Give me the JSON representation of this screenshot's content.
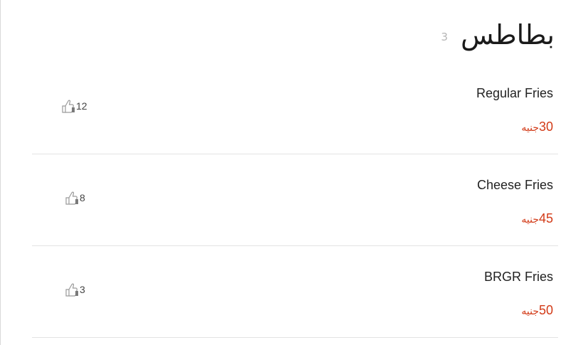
{
  "category": {
    "title": "بطاطس",
    "count": "3"
  },
  "items": [
    {
      "name": "Regular Fries",
      "price": "30",
      "currency": "جنيه",
      "likes": "12"
    },
    {
      "name": "Cheese Fries",
      "price": "45",
      "currency": "جنيه",
      "likes": "8"
    },
    {
      "name": "BRGR Fries",
      "price": "50",
      "currency": "جنيه",
      "likes": "3"
    }
  ],
  "icons": {
    "like": "thumbs-up-icon"
  },
  "colors": {
    "price": "#d23a17",
    "count": "#b5b5b5",
    "divider": "#e3e3e3"
  }
}
